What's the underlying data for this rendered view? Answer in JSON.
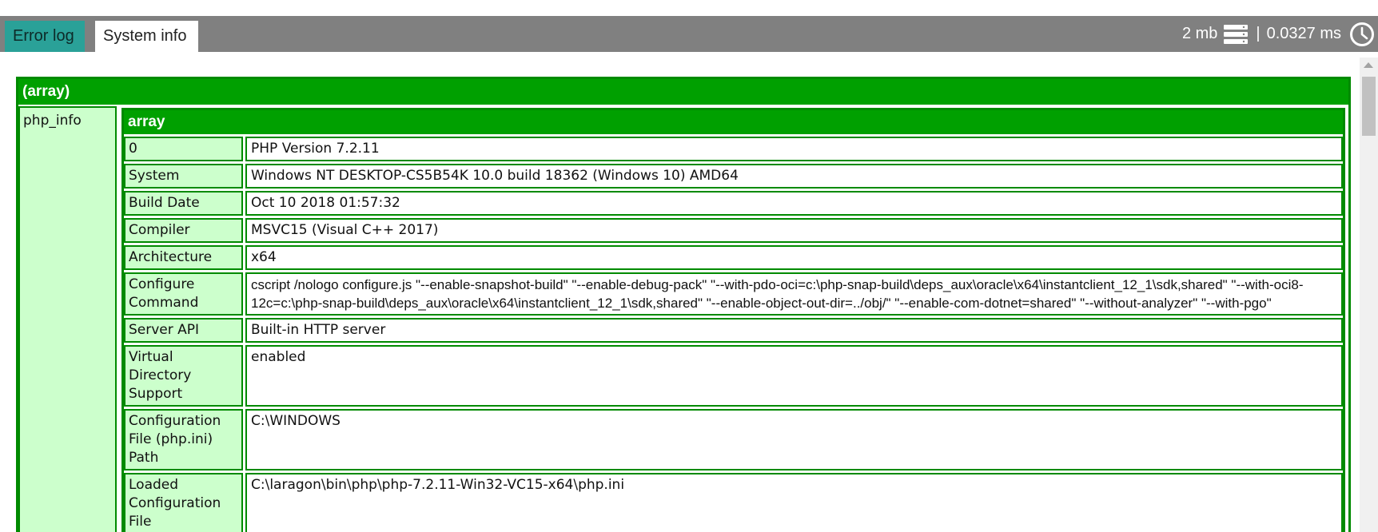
{
  "tabs": [
    {
      "label": "Error log"
    },
    {
      "label": "System info"
    }
  ],
  "stats": {
    "memory": "2 mb",
    "separator": "|",
    "time": "0.0327 ms",
    "memory_icon": "server-icon",
    "time_icon": "clock-icon"
  },
  "dump": {
    "root_type": "(array)",
    "key": "php_info",
    "inner_type": "array",
    "rows": [
      {
        "key": "0",
        "value": "PHP Version 7.2.11"
      },
      {
        "key": "System",
        "value": "Windows NT DESKTOP-CS5B54K 10.0 build 18362 (Windows 10) AMD64"
      },
      {
        "key": "Build Date",
        "value": "Oct 10 2018 01:57:32"
      },
      {
        "key": "Compiler",
        "value": "MSVC15 (Visual C++ 2017)"
      },
      {
        "key": "Architecture",
        "value": "x64"
      },
      {
        "key": "Configure Command",
        "value": "cscript /nologo configure.js \"--enable-snapshot-build\" \"--enable-debug-pack\" \"--with-pdo-oci=c:\\php-snap-build\\deps_aux\\oracle\\x64\\instantclient_12_1\\sdk,shared\" \"--with-oci8-12c=c:\\php-snap-build\\deps_aux\\oracle\\x64\\instantclient_12_1\\sdk,shared\" \"--enable-object-out-dir=../obj/\" \"--enable-com-dotnet=shared\" \"--without-analyzer\" \"--with-pgo\""
      },
      {
        "key": "Server API",
        "value": "Built-in HTTP server"
      },
      {
        "key": "Virtual Directory Support",
        "value": "enabled"
      },
      {
        "key": "Configuration File (php.ini) Path",
        "value": "C:\\WINDOWS"
      },
      {
        "key": "Loaded Configuration File",
        "value": "C:\\laragon\\bin\\php\\php-7.2.11-Win32-VC15-x64\\php.ini"
      }
    ]
  },
  "colors": {
    "header_green": "#00a000",
    "border_green": "#008a00",
    "key_bg": "#ccffcc",
    "topbar": "#808080",
    "active_tab": "#2aa198"
  }
}
